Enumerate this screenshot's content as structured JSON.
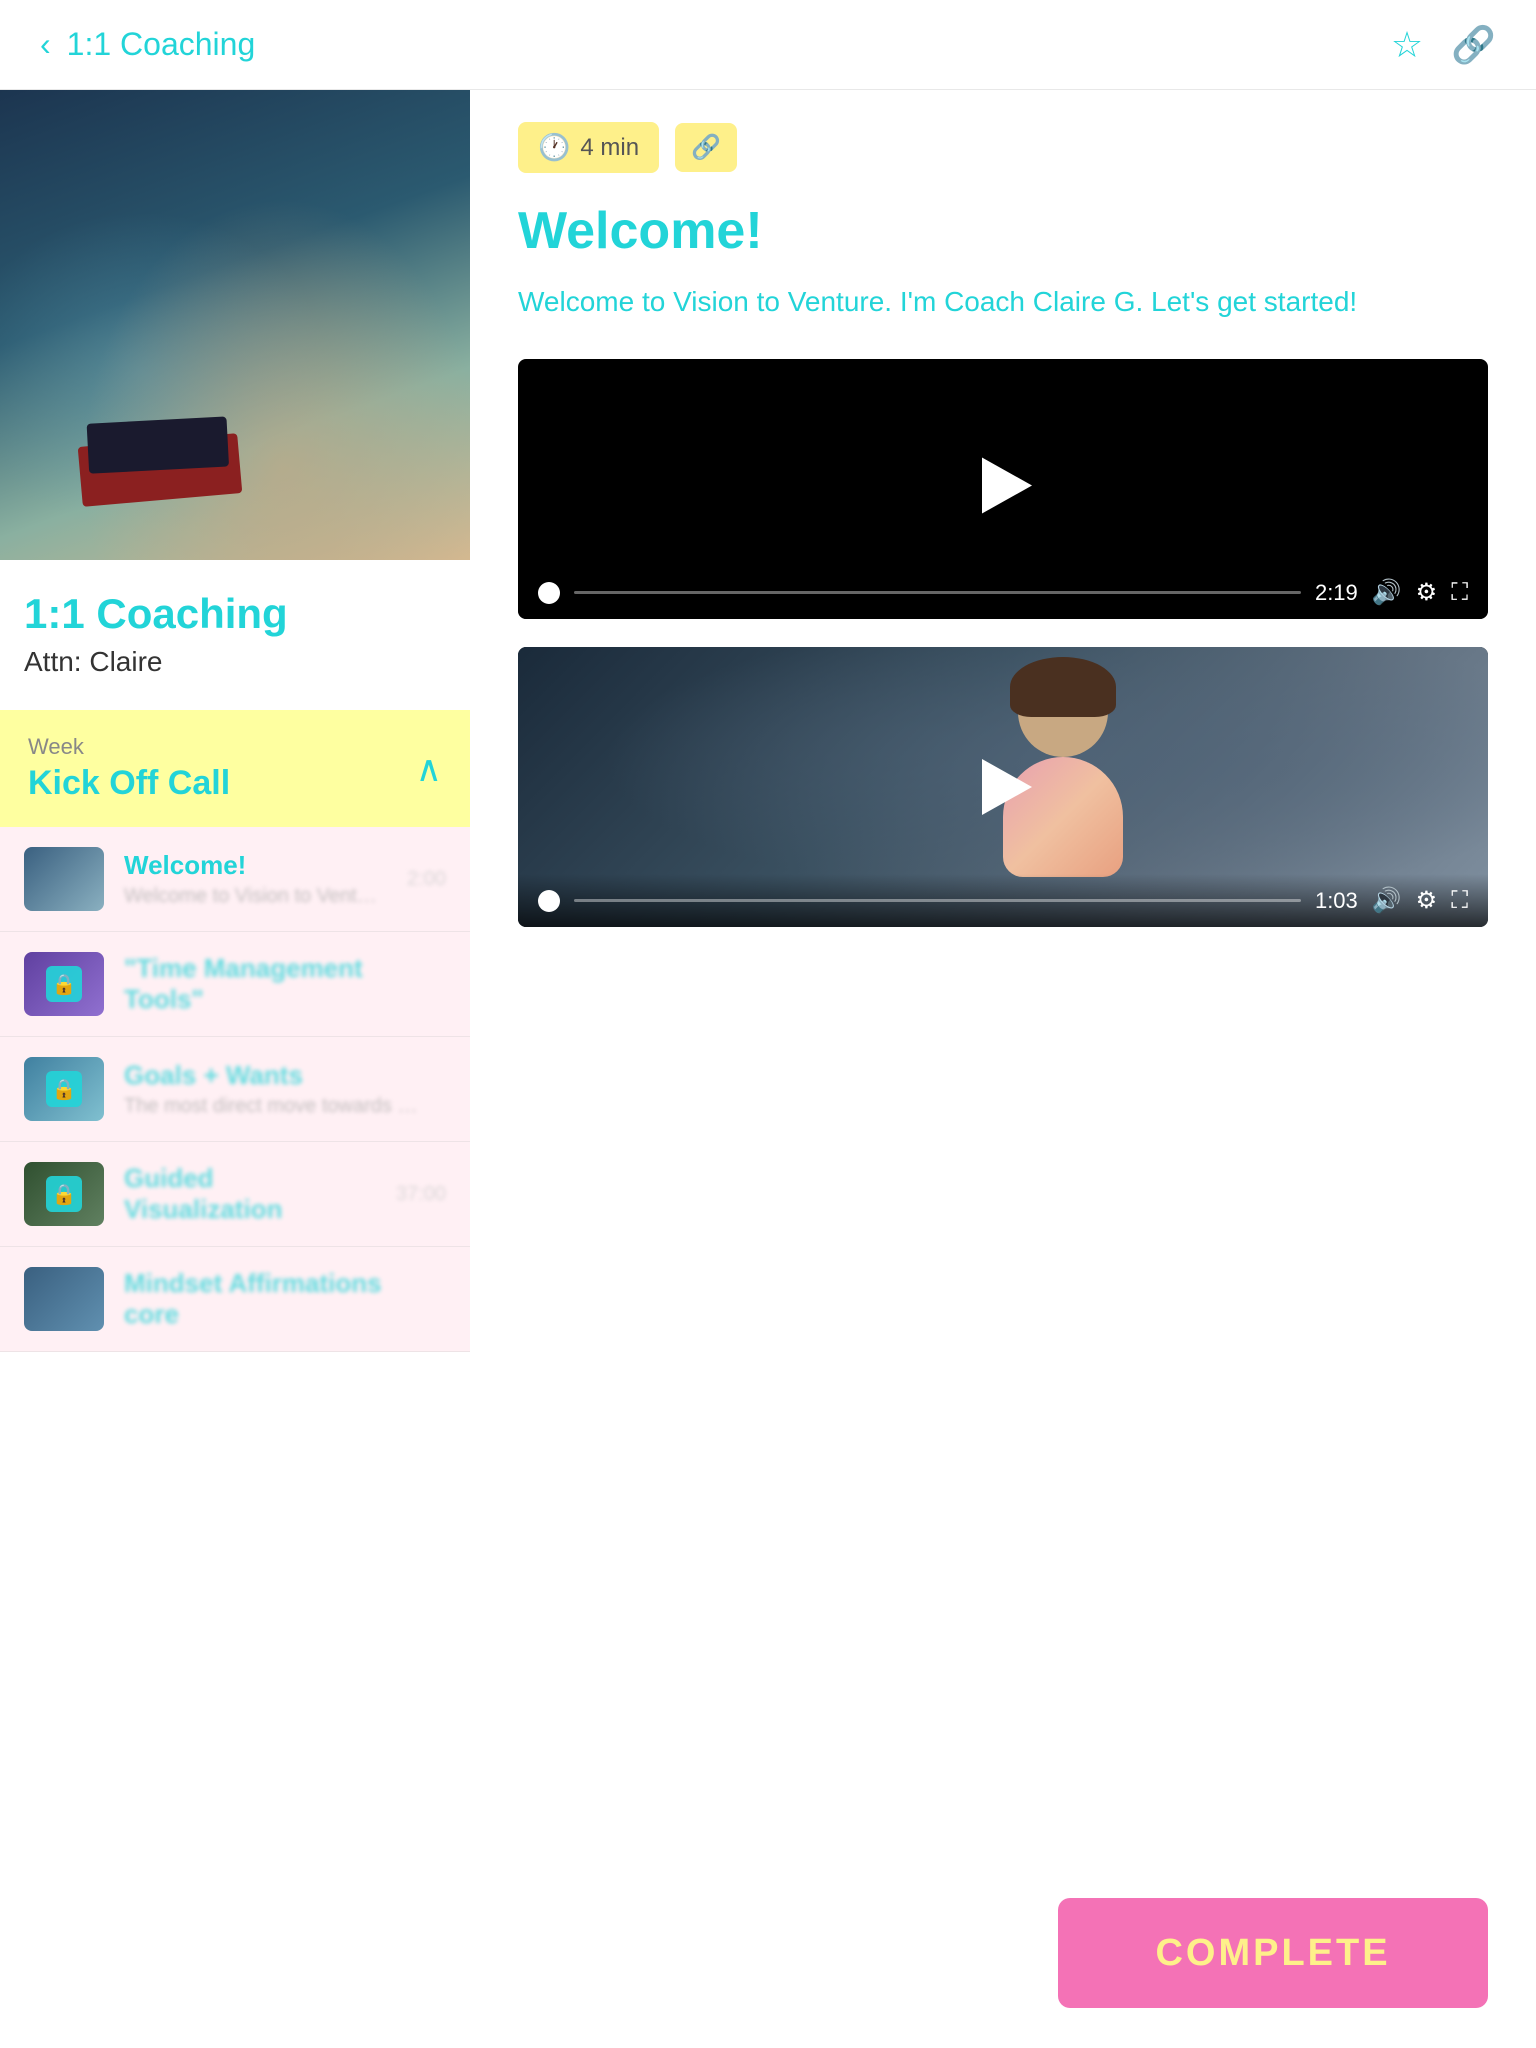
{
  "header": {
    "back_label": "‹",
    "title": "1:1 Coaching",
    "star_icon": "☆",
    "link_icon": "🔗"
  },
  "left_col": {
    "course_title": "1:1 Coaching",
    "course_subtitle": "Attn: Claire",
    "week": {
      "label": "Week",
      "name": "Kick Off Call"
    },
    "lessons": [
      {
        "title": "Welcome!",
        "desc": "Welcome to Vision to Venture. I'm Coach Claire G. Let's get",
        "duration": "2:00",
        "thumb_type": "yoga",
        "locked": false,
        "active": true
      },
      {
        "title": "\"Time Management Tools\"",
        "desc": "",
        "duration": "",
        "thumb_type": "purple",
        "locked": true
      },
      {
        "title": "Goals + Wants",
        "desc": "The most direct move towards what you cannot see",
        "duration": "",
        "thumb_type": "beach",
        "locked": true
      },
      {
        "title": "Guided Visualization",
        "desc": "",
        "duration": "37:00",
        "thumb_type": "forest",
        "locked": true
      },
      {
        "title": "Mindset Affirmations core",
        "desc": "",
        "duration": "",
        "thumb_type": "affirmation",
        "locked": false
      }
    ]
  },
  "right_col": {
    "duration_tag": "4 min",
    "link_tag": "🔗",
    "clock_icon": "🕐",
    "title": "Welcome!",
    "description": "Welcome to Vision to Venture. I'm Coach Claire G. Let's get started!",
    "video1": {
      "time": "2:19"
    },
    "video2": {
      "time": "1:03"
    }
  },
  "complete_button": {
    "label": "COMPLETE"
  }
}
